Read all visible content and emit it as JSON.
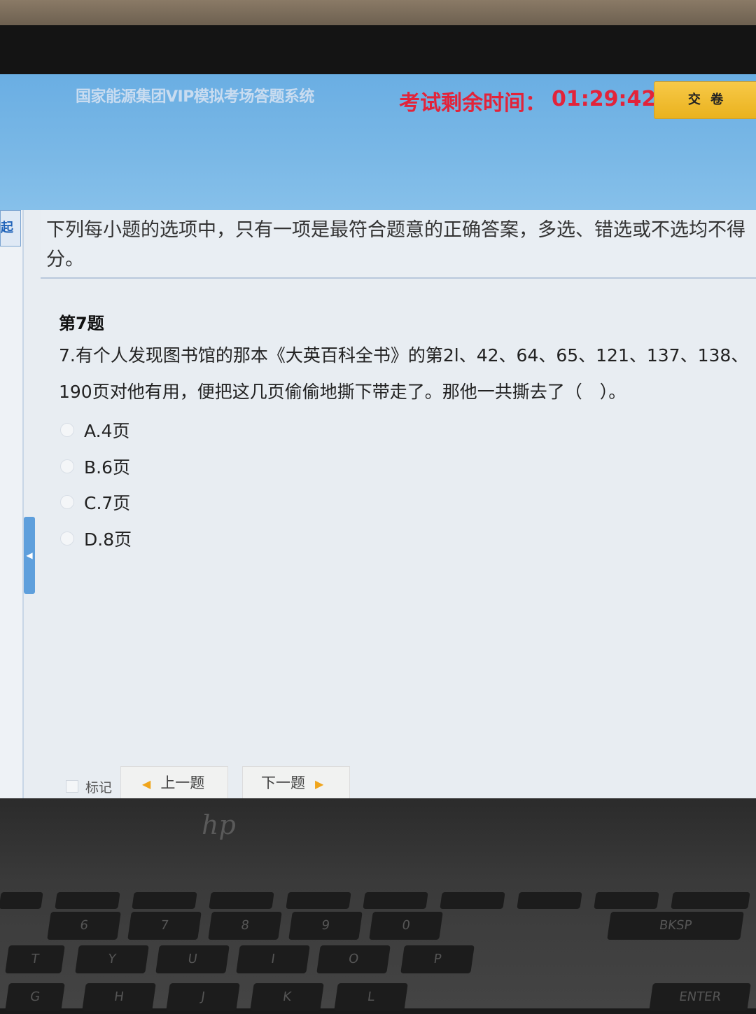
{
  "header": {
    "system_title": "国家能源集团VIP模拟考场答题系统",
    "timer_label": "考试剩余时间：",
    "timer_value": "01:29:42",
    "submit_label": "交 卷"
  },
  "side_tab_label": "起",
  "instruction": "下列每小题的选项中，只有一项是最符合题意的正确答案，多选、错选或不选均不得分。",
  "question": {
    "number_label": "第7题",
    "text": "7.有个人发现图书馆的那本《大英百科全书》的第2l、42、64、65、121、137、138、190页对他有用，便把这几页偷偷地撕下带走了。那他一共撕去了（　）。",
    "options": [
      {
        "label": "A.4页"
      },
      {
        "label": "B.6页"
      },
      {
        "label": "C.7页"
      },
      {
        "label": "D.8页"
      }
    ]
  },
  "footer": {
    "mark_label": "标记",
    "prev_label": "上一题",
    "next_label": "下一题"
  },
  "laptop": {
    "logo": "hp",
    "keys_row1": [
      "6",
      "7",
      "8",
      "9",
      "0",
      "BKSP"
    ],
    "keys_row2": [
      "T",
      "Y",
      "U",
      "I",
      "O",
      "P"
    ],
    "keys_row3": [
      "G",
      "H",
      "J",
      "K",
      "L",
      "ENTER"
    ]
  },
  "colors": {
    "header_blue": "#7ab8e6",
    "timer_red": "#e2233a",
    "submit_yellow": "#f2bf36",
    "nav_arrow_orange": "#f0a51c"
  }
}
